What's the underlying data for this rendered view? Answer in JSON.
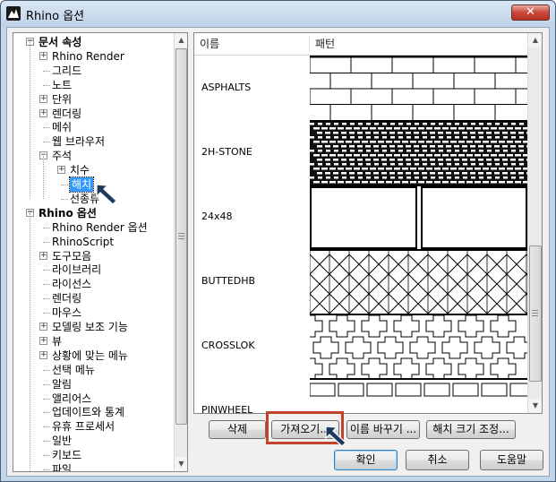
{
  "window": {
    "title": "Rhino 옵션",
    "close_glyph": "✕"
  },
  "tree": {
    "items": [
      {
        "label": "문서 속성",
        "bold": true,
        "expander": "−",
        "level": 0
      },
      {
        "label": "Rhino Render",
        "expander": "+",
        "level": 1
      },
      {
        "label": "그리드",
        "level": 1
      },
      {
        "label": "노트",
        "level": 1
      },
      {
        "label": "단위",
        "expander": "+",
        "level": 1
      },
      {
        "label": "렌더링",
        "expander": "+",
        "level": 1
      },
      {
        "label": "메쉬",
        "level": 1
      },
      {
        "label": "웹 브라우저",
        "level": 1
      },
      {
        "label": "주석",
        "expander": "−",
        "level": 1
      },
      {
        "label": "치수",
        "expander": "+",
        "level": 2
      },
      {
        "label": "해치",
        "level": 2,
        "selected": true
      },
      {
        "label": "선종류",
        "level": 2
      },
      {
        "label": "Rhino 옵션",
        "bold": true,
        "expander": "−",
        "level": 0
      },
      {
        "label": "Rhino Render 옵션",
        "level": 1
      },
      {
        "label": "RhinoScript",
        "level": 1
      },
      {
        "label": "도구모음",
        "expander": "+",
        "level": 1
      },
      {
        "label": "라이브러리",
        "level": 1
      },
      {
        "label": "라이선스",
        "level": 1
      },
      {
        "label": "렌더링",
        "level": 1
      },
      {
        "label": "마우스",
        "level": 1
      },
      {
        "label": "모델링 보조 기능",
        "expander": "+",
        "level": 1
      },
      {
        "label": "뷰",
        "expander": "+",
        "level": 1
      },
      {
        "label": "상황에 맞는 메뉴",
        "expander": "+",
        "level": 1
      },
      {
        "label": "선택 메뉴",
        "level": 1
      },
      {
        "label": "알림",
        "level": 1
      },
      {
        "label": "앨리어스",
        "level": 1
      },
      {
        "label": "업데이트와 통계",
        "level": 1
      },
      {
        "label": "유휴 프로세서",
        "level": 1
      },
      {
        "label": "일반",
        "level": 1
      },
      {
        "label": "키보드",
        "level": 1
      },
      {
        "label": "파일",
        "level": 1
      }
    ]
  },
  "list": {
    "columns": [
      "이름",
      "패턴"
    ],
    "rows": [
      {
        "name": "ASPHALTS",
        "pattern": "running-bond"
      },
      {
        "name": "2H-STONE",
        "pattern": "dense-stone"
      },
      {
        "name": "24x48",
        "pattern": "large-panels"
      },
      {
        "name": "BUTTEDHB",
        "pattern": "herringbone"
      },
      {
        "name": "CROSSLOK",
        "pattern": "crosslock"
      },
      {
        "name": "PINWHEEL",
        "pattern": "pinwheel"
      }
    ]
  },
  "actions": {
    "delete": "삭제",
    "import": "가져오기...",
    "rename": "이름 바꾸기 ...",
    "scale": "해치 크기 조정..."
  },
  "dialog": {
    "ok": "확인",
    "cancel": "취소",
    "help": "도움말"
  },
  "icons": {
    "expand": "plus-box-icon",
    "collapse": "minus-box-icon",
    "pointer": "annotation-arrow-icon"
  },
  "colors": {
    "selection": "#3399ff",
    "highlight": "#c0442c",
    "arrow": "#1f3a60"
  }
}
